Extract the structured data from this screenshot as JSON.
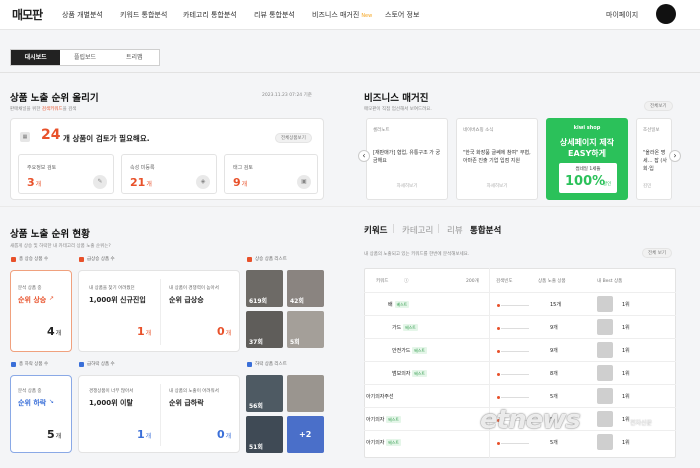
{
  "nav": {
    "logo": "매모판",
    "items": [
      "상품 개별분석",
      "키워드 통합분석",
      "카테고리 통합분석",
      "리뷰 통합분석",
      "비즈니스 매거진",
      "스토어 정보"
    ],
    "new_badge": "New",
    "mypage": "마이페이지"
  },
  "tabs": [
    "대시보드",
    "플립보드",
    "트리맵"
  ],
  "ranking": {
    "title": "상품 노출 순위 올리기",
    "date": "2023.11.23 07:24 기준",
    "sub_prefix": "판매채널을 위한",
    "sub_highlight": "검색키워드",
    "sub_suffix": "을 검색",
    "count": "24",
    "headline": "개 상품이 검토가 필요해요.",
    "view_all": "전체상품보기",
    "items": [
      {
        "label": "주요정보 검토",
        "value": "3",
        "unit": "개"
      },
      {
        "label": "속성 미등록",
        "value": "21",
        "unit": "개"
      },
      {
        "label": "태그 검토",
        "value": "9",
        "unit": "개"
      }
    ]
  },
  "magazine": {
    "title": "비즈니스 매거진",
    "sub": "매모판이 직접 엄선해서 보여드려요.",
    "view_all": "전체보기",
    "cards": [
      {
        "tag": "셀러노트",
        "body": "[재판매가] 협업, 유통구조 가 궁금해요",
        "link": "자세히보기"
      },
      {
        "tag": "네이버쇼핑 소식",
        "body": "\"한국 화장품 글쎄에 참여\" 무협, 아마존 진출 기업 입점 지원",
        "link": "자세히보기"
      },
      {
        "brand": "kiwi shop",
        "headline": "상세페이지 제작",
        "headline2": "EASY하게",
        "line": "썸네일 1세뜰",
        "pct": "100%",
        "pct_suffix": "할인"
      },
      {
        "tag": "조선일보",
        "body": "\"올라온 명세… 잡 (사회·입",
        "link": "김민"
      }
    ]
  },
  "status": {
    "title": "상품 노출 순위 현황",
    "sub": "새롭게 상승 및 하락한 내 카테고리 상품 노출 순위는?",
    "up": {
      "c1": "총 상승 상품 수",
      "c2": "급상승 상품 수",
      "c3": "상승 상품 리스트",
      "box_label": "분석 상품 중",
      "box_title": "순위 상승",
      "box_val": "4",
      "sub1": "내 상품을 찾기 어려웠던",
      "stat1": "1,000위 신규진입",
      "val1": "1",
      "sub2": "내 상품이 경쟁력이 높아서",
      "stat2": "순위 급상승",
      "val2": "0",
      "thumbs": [
        "619회",
        "42회",
        "37회",
        "5회"
      ]
    },
    "down": {
      "c1": "총 하락 상품 수",
      "c2": "급하락 상품 수",
      "c3": "하락 상품 리스트",
      "box_label": "분석 상품 중",
      "box_title": "순위 하락",
      "box_val": "5",
      "sub1": "경쟁상품이 너무 많아서",
      "stat1": "1,000위 이탈",
      "val1": "1",
      "sub2": "내 상품의 노출이 어려워서",
      "stat2": "순위 급하락",
      "val2": "0",
      "thumbs": [
        "56회",
        "",
        "51회",
        "+2"
      ]
    },
    "unit": "개"
  },
  "keyword": {
    "tabs": [
      "키워드",
      "카테고리",
      "리뷰",
      "통합분석"
    ],
    "sub": "내 상품의 노출되고 있는 키워드를 한번에 분석해보세요.",
    "view_all": "전체 보기",
    "headers": [
      "키워드",
      "200개",
      "검색빈도",
      "상품 노출 상품",
      "내 Best 상품"
    ],
    "rows": [
      {
        "kw": "배",
        "tag": "베스트",
        "cnt": "15개",
        "rank": "1위"
      },
      {
        "kw": "가드",
        "tag": "베스트",
        "cnt": "9개",
        "rank": "1위"
      },
      {
        "kw": "안전가드",
        "tag": "베스트",
        "cnt": "9개",
        "rank": "1위"
      },
      {
        "kw": "범보의자",
        "tag": "베스트",
        "cnt": "8개",
        "rank": "1위"
      },
      {
        "kw": "아기의자주선",
        "tag": "",
        "cnt": "5개",
        "rank": "1위"
      },
      {
        "kw": "아기의자",
        "tag": "베스트",
        "cnt": "5개",
        "rank": "1위"
      },
      {
        "kw": "아기의자",
        "tag": "베스트",
        "cnt": "5개",
        "rank": "1위"
      }
    ]
  },
  "watermark": {
    "text": "etnews",
    "sub": "전자신문"
  }
}
